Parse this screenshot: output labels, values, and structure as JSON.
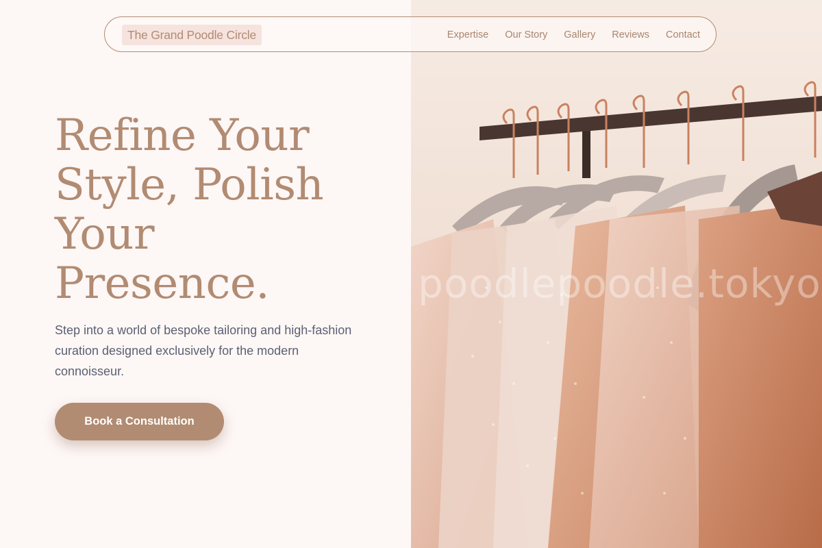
{
  "nav": {
    "brand": "The Grand Poodle Circle",
    "links": [
      "Expertise",
      "Our Story",
      "Gallery",
      "Reviews",
      "Contact"
    ]
  },
  "hero": {
    "title_lines": [
      "Refine Your",
      "Style, Polish",
      "Your",
      "Presence."
    ],
    "subtitle": "Step into a world of bespoke tailoring and high-fashion curation designed exclusively for the modern connoisseur.",
    "cta_label": "Book a Consultation"
  },
  "image": {
    "watermark": "poodlepoodle.tokyo"
  },
  "colors": {
    "accent": "#b18b72",
    "background": "#fdf7f6",
    "brand_highlight": "#f6e3de",
    "body_text": "#5b6172"
  }
}
